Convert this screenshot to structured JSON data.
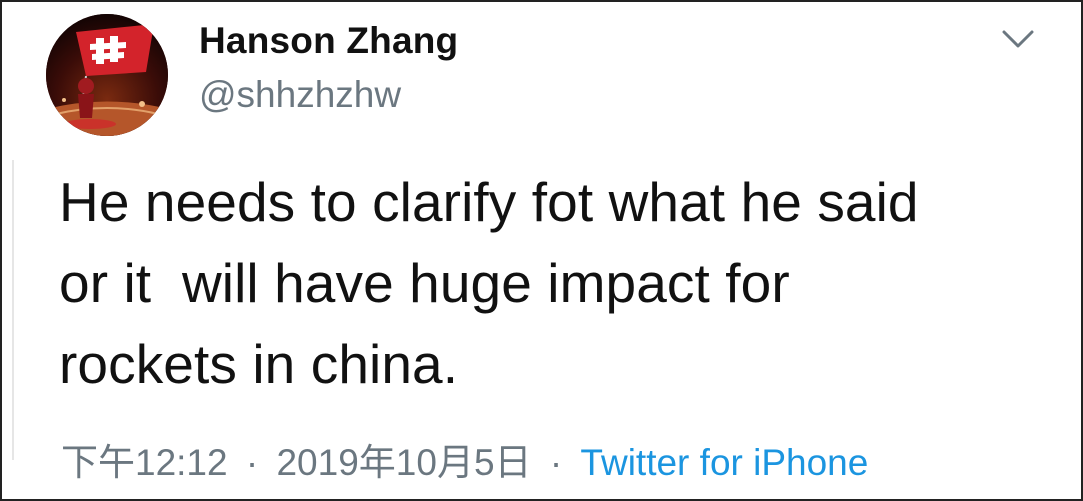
{
  "user": {
    "display_name": "Hanson Zhang",
    "handle": "@shhzhzhw",
    "avatar_icon": "rockets-flag-avatar"
  },
  "tweet": {
    "text": "He needs to clarify fot what he said\nor it  will have huge impact for\nrockets in china."
  },
  "meta": {
    "time": "下午12:12",
    "separator": "·",
    "date": "2019年10月5日",
    "source": "Twitter for iPhone"
  },
  "menu": {
    "icon": "chevron-down-icon"
  },
  "colors": {
    "text": "#111111",
    "muted": "#6b7780",
    "link": "#1b95e0"
  }
}
